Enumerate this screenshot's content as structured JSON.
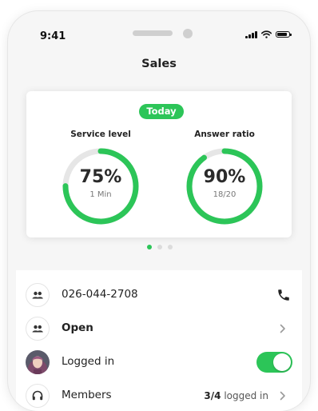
{
  "status_bar": {
    "time": "9:41"
  },
  "nav": {
    "title": "Sales"
  },
  "stats": {
    "badge": "Today",
    "service_level": {
      "label": "Service level",
      "value": "75%",
      "sub": "1 Min",
      "fraction": 0.75
    },
    "answer_ratio": {
      "label": "Answer ratio",
      "value": "90%",
      "sub": "18/20",
      "fraction": 0.9
    }
  },
  "pager": {
    "pages": 3,
    "active": 1
  },
  "rows": {
    "phone": {
      "label": "026-044-2708",
      "icon": "group-icon",
      "action_icon": "phone-icon"
    },
    "status": {
      "label": "Open",
      "icon": "group-icon"
    },
    "login": {
      "label": "Logged in",
      "toggle_on": true
    },
    "members": {
      "label": "Members",
      "count": "3/4",
      "suffix": "logged in",
      "icon": "headset-icon"
    }
  },
  "colors": {
    "accent": "#2cc558",
    "track": "#e6e6e6"
  }
}
